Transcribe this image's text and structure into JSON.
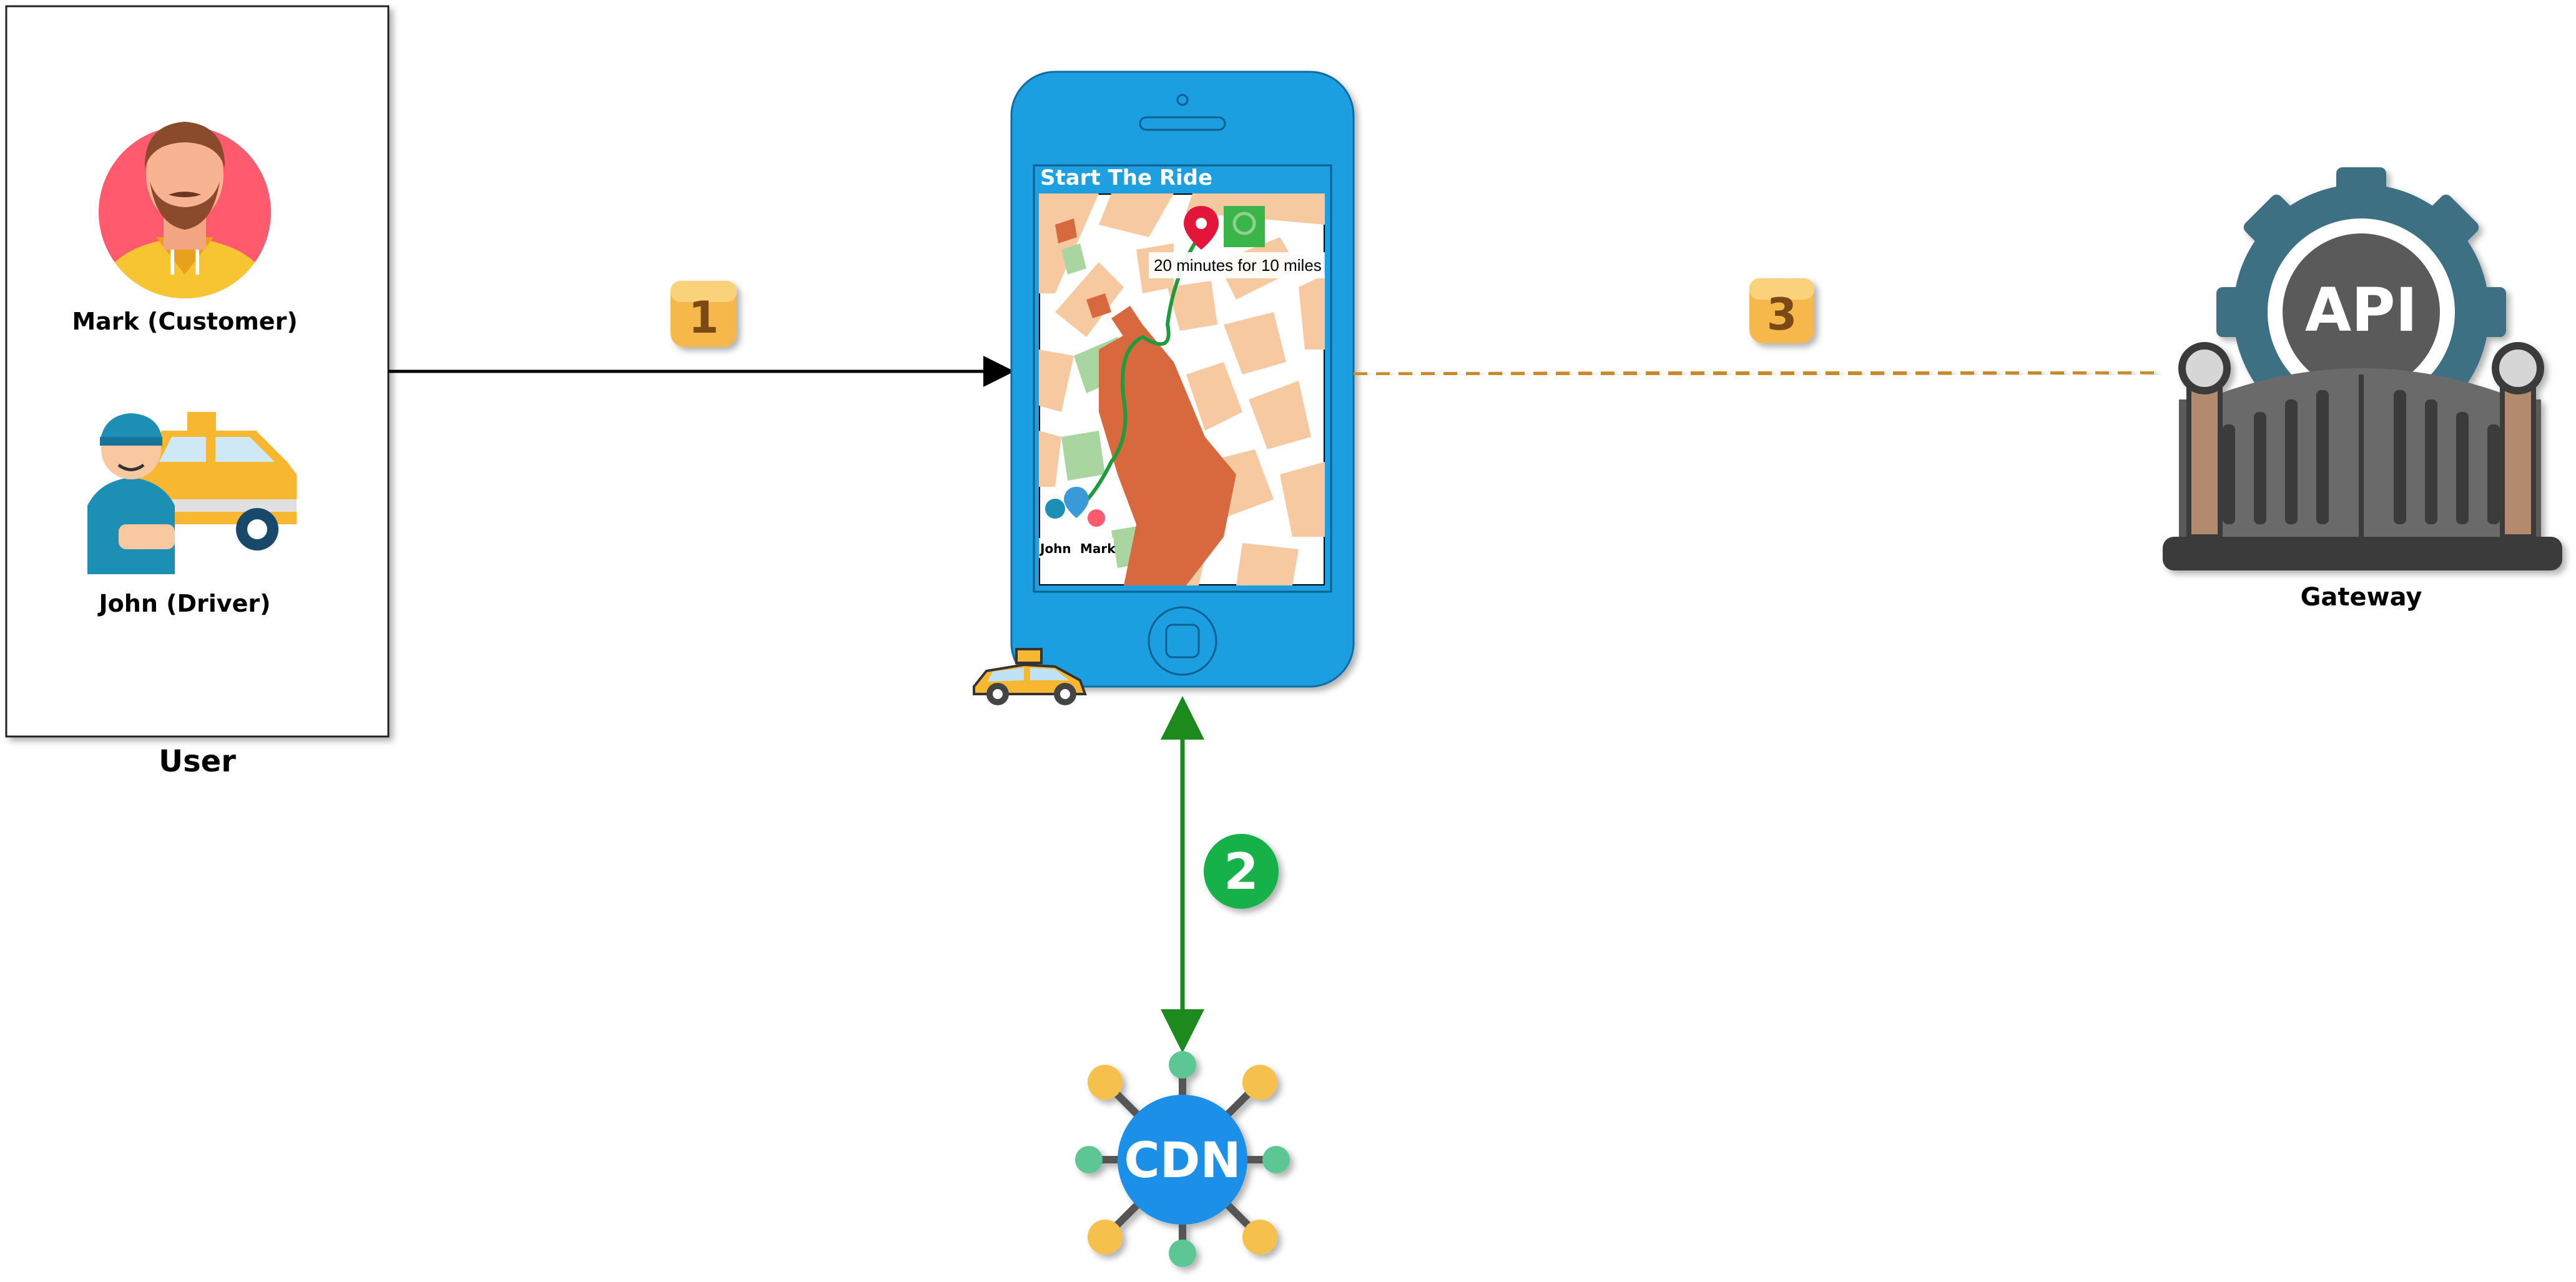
{
  "user_panel": {
    "title": "User",
    "customer_label": "Mark (Customer)",
    "driver_label": "John (Driver)"
  },
  "phone": {
    "screen_title": "Start The Ride",
    "route_info": "20 minutes for 10 miles",
    "driver_pin_label": "John",
    "customer_pin_label": "Mark"
  },
  "steps": {
    "step1": "1",
    "step2": "2",
    "step3": "3"
  },
  "gateway": {
    "icon_text": "API",
    "label": "Gateway"
  },
  "cdn": {
    "icon_text": "CDN"
  },
  "colors": {
    "phone_body": "#1e9fe0",
    "step_badge": "#f7b84b",
    "step2_badge": "#18b14a",
    "cdn_blue": "#1e90e8",
    "gear": "#3e6f82",
    "gate": "#5a5a5a",
    "arrow_green": "#1c8a1c",
    "dashed_orange": "#c98a2e"
  }
}
